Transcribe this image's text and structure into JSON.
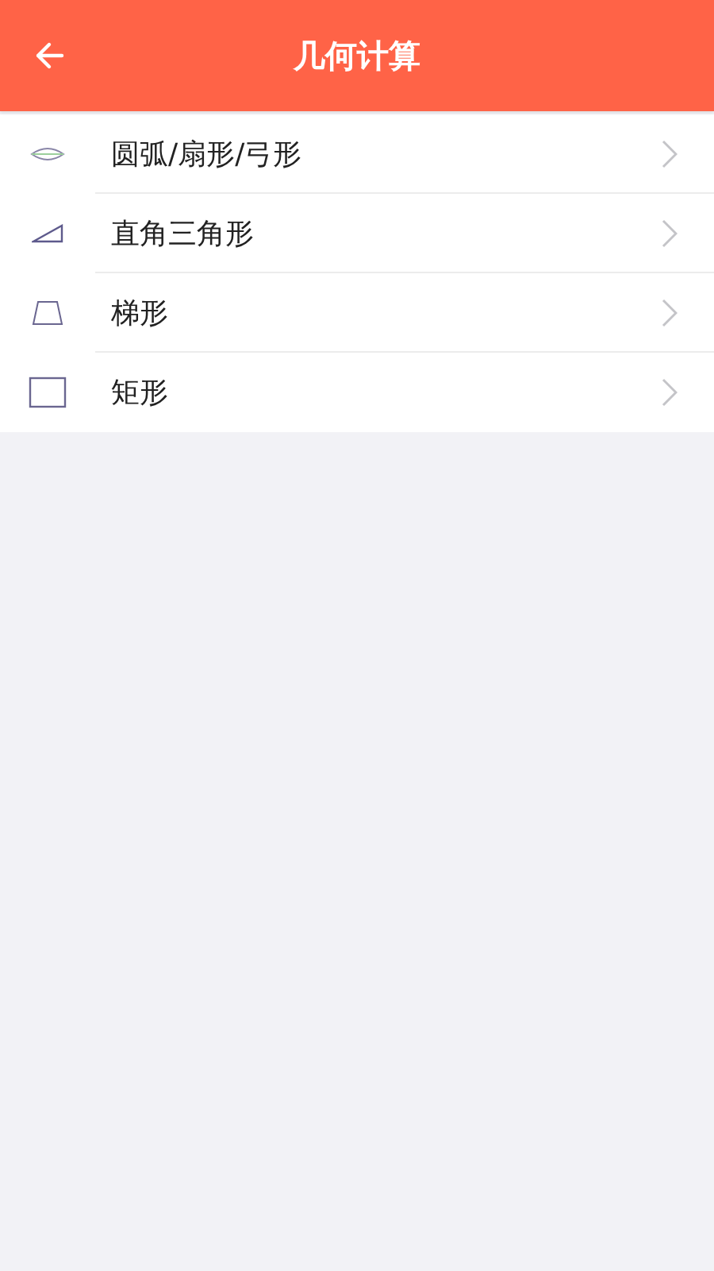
{
  "header": {
    "title": "几何计算"
  },
  "items": [
    {
      "label": "圆弧/扇形/弓形",
      "kind": "arc"
    },
    {
      "label": "直角三角形",
      "kind": "triangle"
    },
    {
      "label": "梯形",
      "kind": "trapezoid"
    },
    {
      "label": "矩形",
      "kind": "rectangle"
    }
  ]
}
